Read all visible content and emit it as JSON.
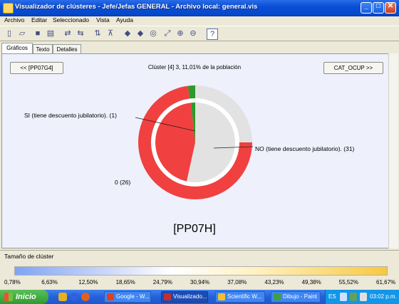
{
  "window": {
    "title": "Visualizador de clústeres - Jefe/Jefas GENERAL - Archivo local: general.vis"
  },
  "menu": [
    "Archivo",
    "Editar",
    "Seleccionado",
    "Vista",
    "Ayuda"
  ],
  "tabs": [
    "Gráficos",
    "Texto",
    "Detalles"
  ],
  "nav": {
    "prev": "<< [PP07G4]",
    "next": "CAT_OCUP >>"
  },
  "cluster": {
    "title": "Clúster [4] 3, 11,01% de la población",
    "field": "[PP07H]",
    "labels": {
      "si": "SI  (tiene descuento jubilatorio). (1)",
      "no": "NO  (tiene descuento jubilatorio). (31)",
      "zero": "0 (26)"
    },
    "colors": {
      "si": "#2a9a2a",
      "no": "#e2e2e2",
      "zero": "#f04040"
    }
  },
  "chart_data": {
    "type": "pie",
    "categories": [
      "NO (tiene descuento jubilatorio)",
      "0",
      "SI (tiene descuento jubilatorio)"
    ],
    "inner_ring_values": [
      31,
      26,
      1
    ],
    "outer_ring_percent": [
      25,
      73,
      2
    ]
  },
  "size_bar": {
    "label": "Tamaño de clúster",
    "ticks": [
      "0,78%",
      "6,63%",
      "12,50%",
      "18,65%",
      "24,79%",
      "30,94%",
      "37,08%",
      "43,23%",
      "49,38%",
      "55,52%",
      "61,67%"
    ]
  },
  "taskbar": {
    "start": "Inicio",
    "tasks": [
      "Google - W...",
      "Visualizado...",
      "Scientific W...",
      "Dibujo - Paint"
    ],
    "lang": "ES",
    "clock": "03:02 p.m."
  }
}
